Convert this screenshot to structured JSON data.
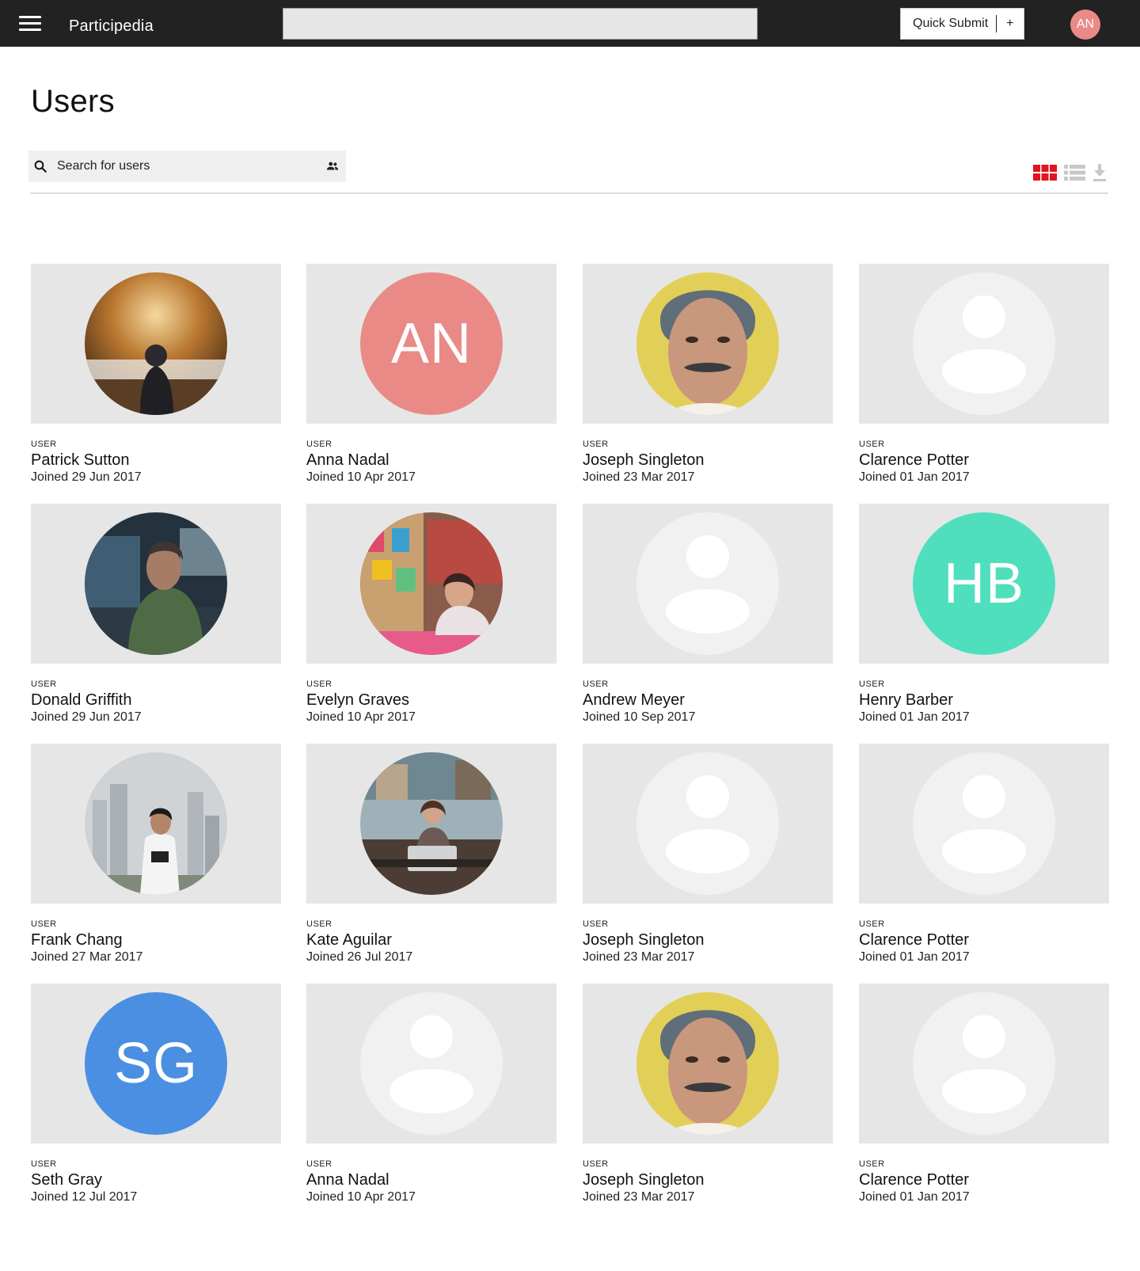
{
  "topbar": {
    "brand": "Participedia",
    "quick_submit_label": "Quick Submit",
    "quick_submit_plus": "+",
    "user_initials": "AN"
  },
  "page": {
    "title": "Users"
  },
  "search": {
    "placeholder": "Search for users"
  },
  "toolbar": {
    "grid_icon": "grid-view-icon",
    "list_icon": "list-view-icon",
    "download_icon": "download-icon"
  },
  "colors": {
    "topbar_bg": "#222222",
    "accent_red": "#e0161f",
    "avatar_AN": "#e98a87",
    "avatar_HB": "#50dfbd",
    "avatar_SG": "#4a8fe2"
  },
  "users": [
    {
      "role": "USER",
      "name": "Patrick Sutton",
      "joined": "Joined 29 Jun 2017",
      "avatar": "photo-forest"
    },
    {
      "role": "USER",
      "name": "Anna Nadal",
      "joined": "Joined 10 Apr 2017",
      "avatar": "initials",
      "initials": "AN"
    },
    {
      "role": "USER",
      "name": "Joseph Singleton",
      "joined": "Joined 23 Mar 2017",
      "avatar": "photo-old-man"
    },
    {
      "role": "USER",
      "name": "Clarence Potter",
      "joined": "Joined 01 Jan 2017",
      "avatar": "placeholder"
    },
    {
      "role": "USER",
      "name": "Donald Griffith",
      "joined": "Joined 29 Jun 2017",
      "avatar": "photo-man-jacket"
    },
    {
      "role": "USER",
      "name": "Evelyn Graves",
      "joined": "Joined 10 Apr 2017",
      "avatar": "photo-woman-market"
    },
    {
      "role": "USER",
      "name": "Andrew Meyer",
      "joined": "Joined 10 Sep 2017",
      "avatar": "placeholder"
    },
    {
      "role": "USER",
      "name": "Henry Barber",
      "joined": "Joined 01 Jan 2017",
      "avatar": "initials",
      "initials": "HB"
    },
    {
      "role": "USER",
      "name": "Frank Chang",
      "joined": "Joined 27 Mar 2017",
      "avatar": "photo-city-man"
    },
    {
      "role": "USER",
      "name": "Kate Aguilar",
      "joined": "Joined 26 Jul 2017",
      "avatar": "photo-woman-laptop"
    },
    {
      "role": "USER",
      "name": "Joseph Singleton",
      "joined": "Joined 23 Mar 2017",
      "avatar": "placeholder"
    },
    {
      "role": "USER",
      "name": "Clarence Potter",
      "joined": "Joined 01 Jan 2017",
      "avatar": "placeholder"
    },
    {
      "role": "USER",
      "name": "Seth Gray",
      "joined": "Joined 12 Jul 2017",
      "avatar": "initials",
      "initials": "SG"
    },
    {
      "role": "USER",
      "name": "Anna Nadal",
      "joined": "Joined 10 Apr 2017",
      "avatar": "placeholder"
    },
    {
      "role": "USER",
      "name": "Joseph Singleton",
      "joined": "Joined 23 Mar 2017",
      "avatar": "photo-old-man"
    },
    {
      "role": "USER",
      "name": "Clarence Potter",
      "joined": "Joined 01 Jan 2017",
      "avatar": "placeholder"
    }
  ]
}
